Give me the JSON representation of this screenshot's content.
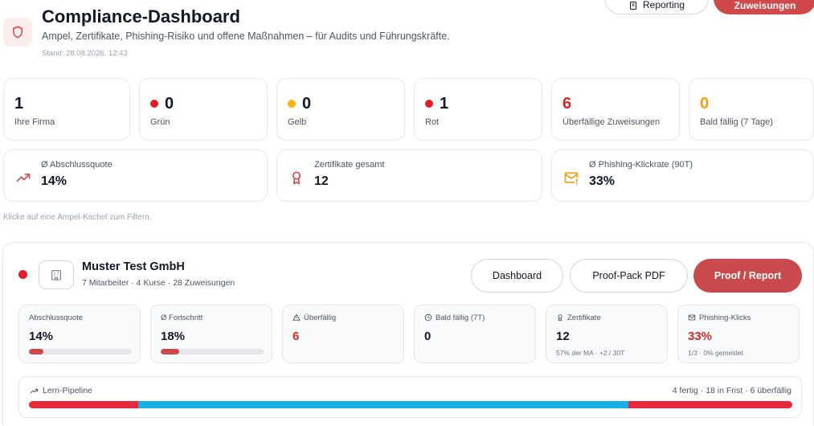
{
  "header": {
    "title": "Compliance-Dashboard",
    "subtitle": "Ampel, Zertifikate, Phishing-Risiko und offene Maßnahmen – für Audits und Führungskräfte.",
    "stand": "Stand: 28.08.2026, 12:43",
    "reporting_label": "Reporting",
    "zuweisungen_label": "Zuweisungen"
  },
  "tiles": [
    {
      "value": "1",
      "label": "Ihre Firma"
    },
    {
      "value": "0",
      "label": "Grün"
    },
    {
      "value": "0",
      "label": "Gelb"
    },
    {
      "value": "1",
      "label": "Rot"
    },
    {
      "value": "6",
      "label": "Überfällige Zuweisungen"
    },
    {
      "value": "0",
      "label": "Bald fällig (7 Tage)"
    }
  ],
  "stats": [
    {
      "label": "Ø Abschlussquote",
      "value": "14%",
      "icon": "trending-up-icon"
    },
    {
      "label": "Zertifikate gesamt",
      "value": "12",
      "icon": "award-icon"
    },
    {
      "label": "Ø Phishing-Klickrate (90T)",
      "value": "33%",
      "icon": "mail-alert-icon"
    }
  ],
  "hint": "Klicke auf eine Ampel-Kachel zum Filtern.",
  "company": {
    "name": "Muster Test GmbH",
    "meta": "7 Mitarbeiter · 4 Kurse · 28 Zuweisungen",
    "buttons": {
      "dashboard": "Dashboard",
      "proofpack": "Proof-Pack PDF",
      "proof_report": "Proof / Report"
    },
    "metrics": [
      {
        "label": "Abschlussquote",
        "value": "14%",
        "progress": 0.14
      },
      {
        "label": "Ø Fortschritt",
        "value": "18%",
        "progress": 0.18
      },
      {
        "label": "Überfällig",
        "value": "6"
      },
      {
        "label": "Bald fällig (7T)",
        "value": "0"
      },
      {
        "label": "Zertifikate",
        "value": "12",
        "sub": "57% der MA · +2 / 30T"
      },
      {
        "label": "Phishing-Klicks",
        "value": "33%",
        "sub": "1/3 · 0% gemeldet"
      }
    ],
    "pipeline": {
      "label": "Lern-Pipeline",
      "summary": "4 fertig · 18 in Frist · 6 überfällig",
      "segments": [
        {
          "name": "fertig",
          "count": 4,
          "color": "#e62a3a"
        },
        {
          "name": "in Frist",
          "count": 18,
          "color": "#17b0e6"
        },
        {
          "name": "überfällig",
          "count": 6,
          "color": "#e62a3a"
        }
      ]
    }
  },
  "colors": {
    "accent": "#d0494a",
    "green": "#16a34a",
    "yellow": "#f5b50a",
    "red": "#e11d28",
    "orange": "#f59e0b",
    "overdue": "#dc2626"
  }
}
